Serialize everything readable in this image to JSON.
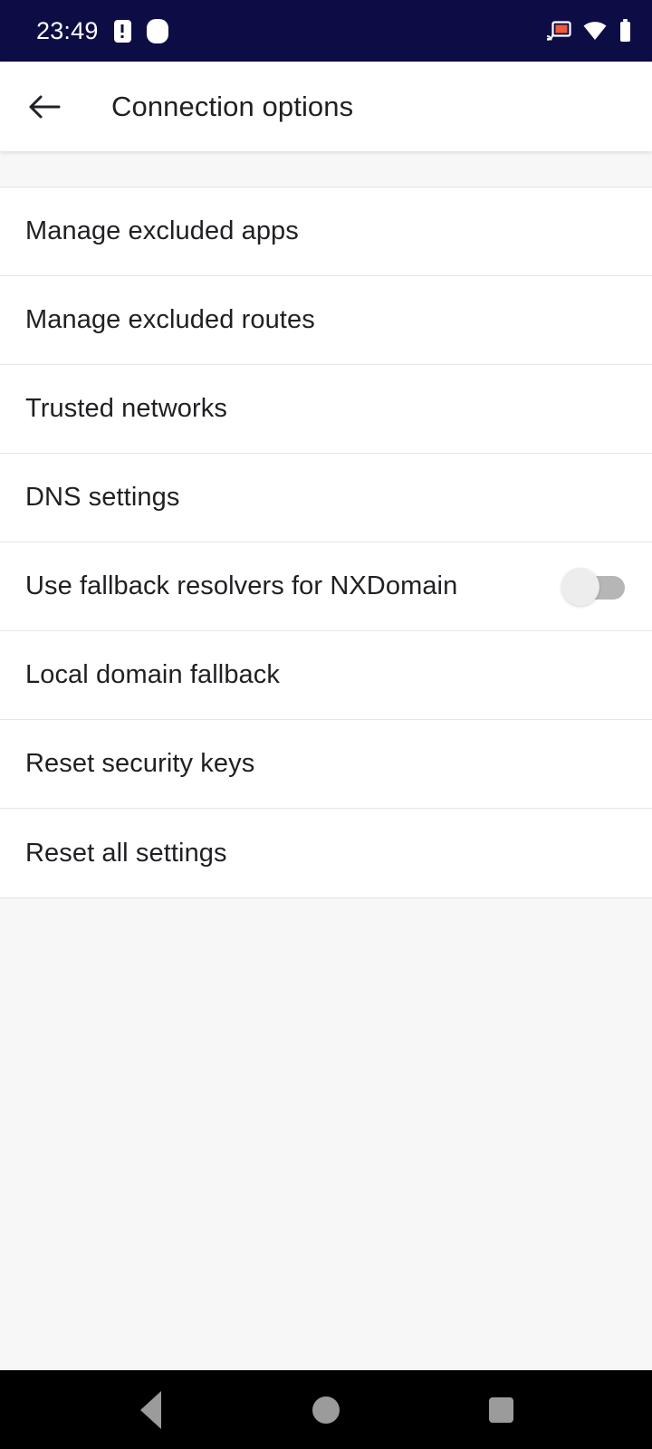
{
  "status_bar": {
    "time": "23:49",
    "left_icons": [
      {
        "name": "notification-warning-icon"
      },
      {
        "name": "notification-dot-icon"
      }
    ],
    "right_icons": [
      {
        "name": "cast-icon",
        "color": "#ef5b36"
      },
      {
        "name": "wifi-icon",
        "color": "#ffffff"
      },
      {
        "name": "battery-icon",
        "color": "#ffffff"
      }
    ],
    "background": "#0d0d46"
  },
  "app_bar": {
    "back_label": "Back",
    "title": "Connection options"
  },
  "settings": {
    "items": [
      {
        "label": "Manage excluded apps",
        "type": "navigation"
      },
      {
        "label": "Manage excluded routes",
        "type": "navigation"
      },
      {
        "label": "Trusted networks",
        "type": "navigation"
      },
      {
        "label": "DNS settings",
        "type": "navigation"
      },
      {
        "label": "Use fallback resolvers for NXDomain",
        "type": "switch",
        "checked": false
      },
      {
        "label": "Local domain fallback",
        "type": "navigation"
      },
      {
        "label": "Reset security keys",
        "type": "navigation"
      },
      {
        "label": "Reset all settings",
        "type": "navigation"
      }
    ]
  },
  "nav_bar": {
    "buttons": [
      {
        "name": "nav-back-button"
      },
      {
        "name": "nav-home-button"
      },
      {
        "name": "nav-recents-button"
      }
    ]
  }
}
